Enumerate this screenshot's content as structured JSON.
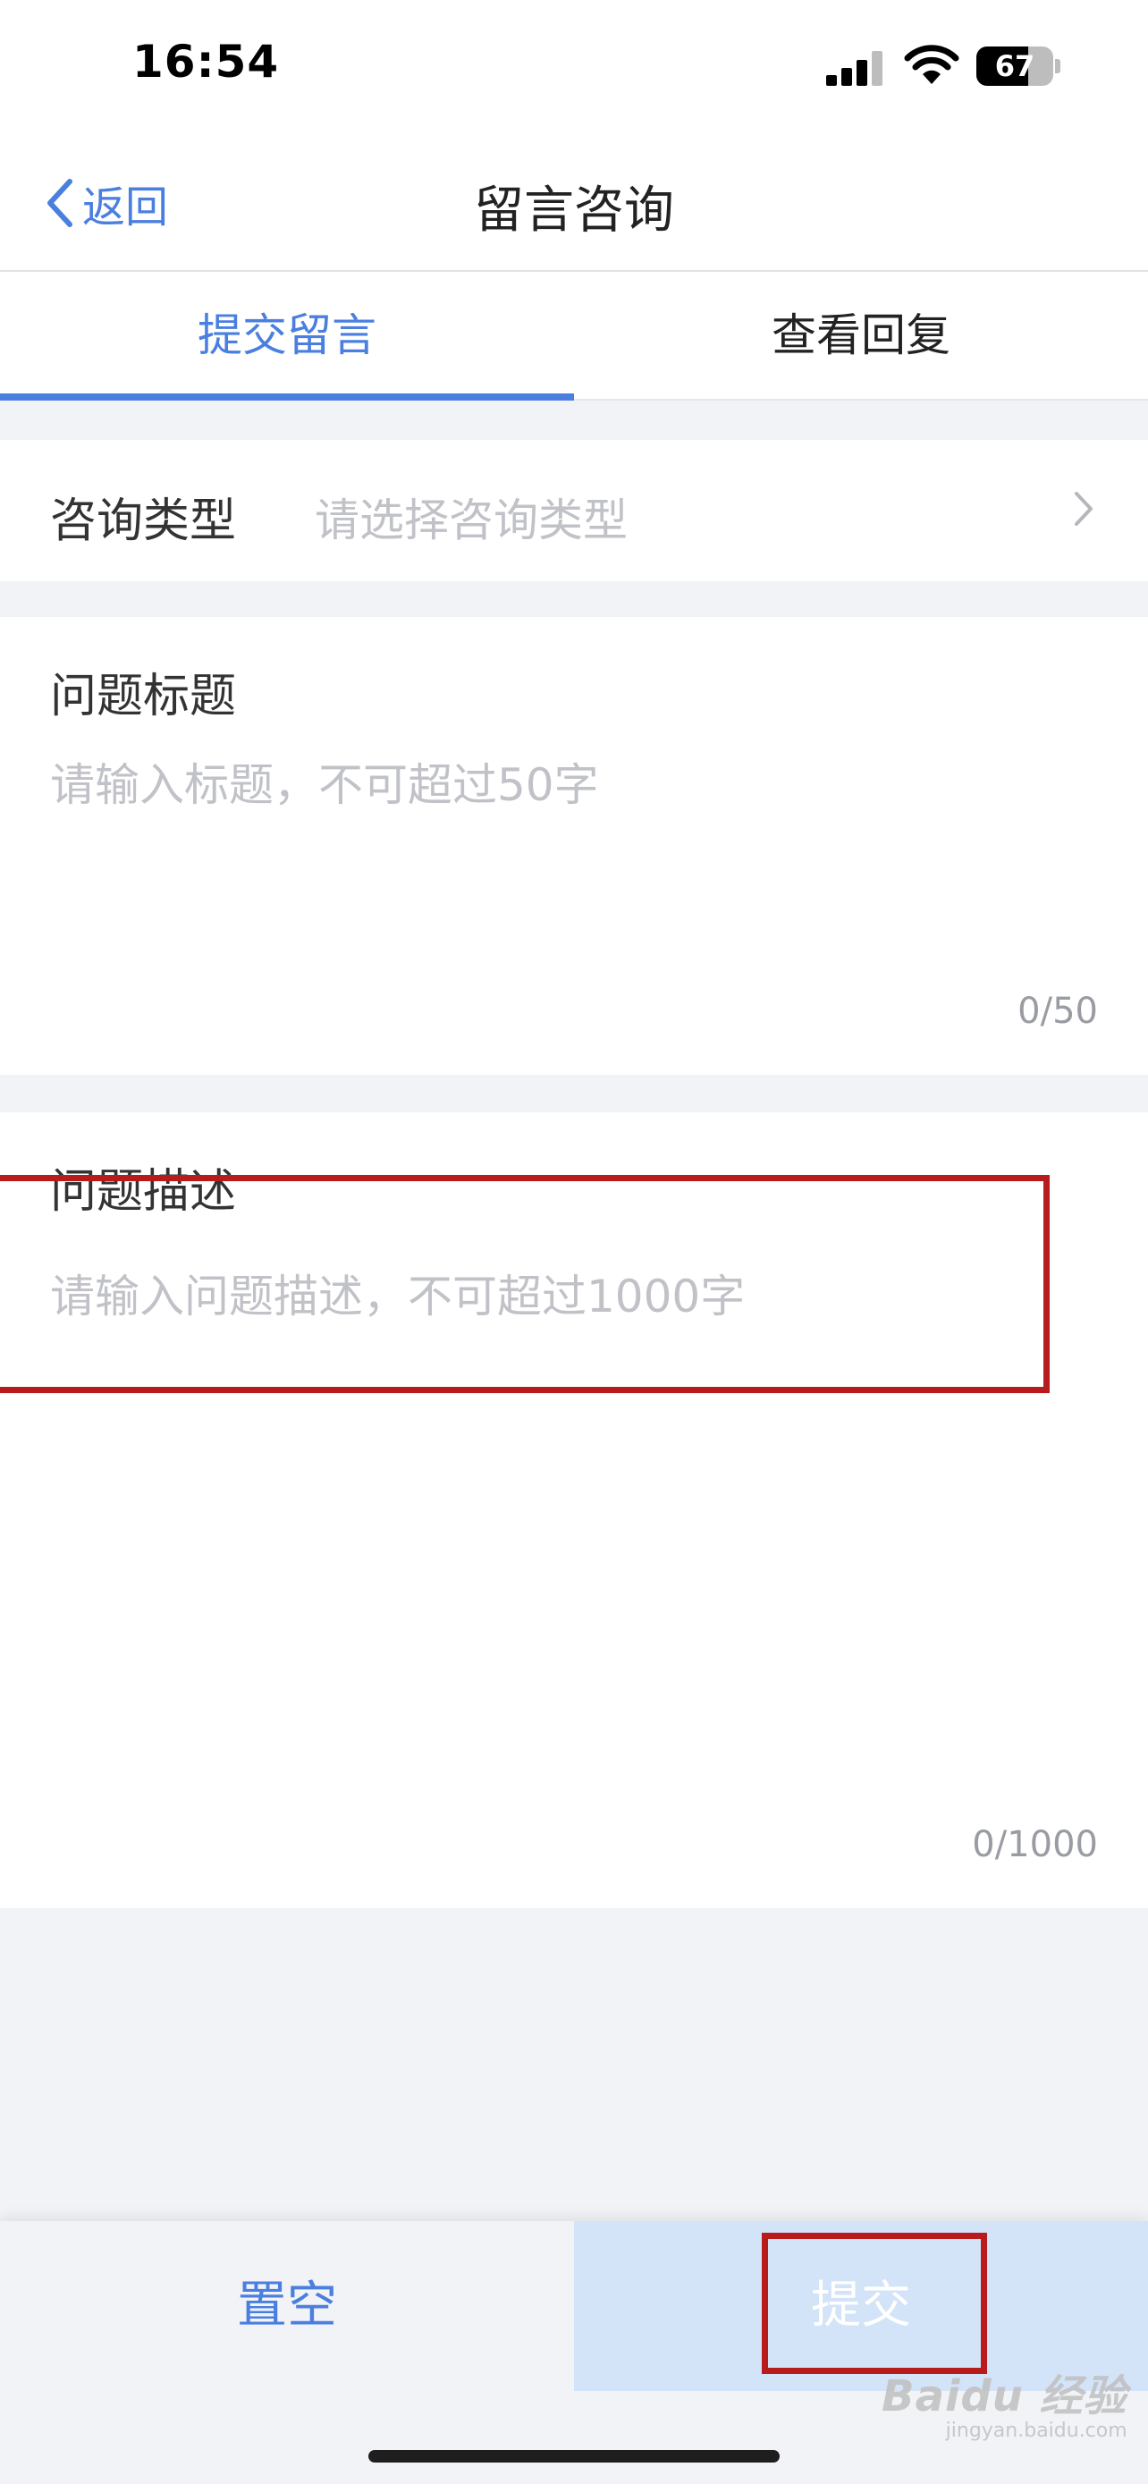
{
  "status_bar": {
    "time": "16:54",
    "battery_level": 67,
    "battery_text": "67"
  },
  "nav": {
    "back_label": "返回",
    "title": "留言咨询"
  },
  "tabs": [
    {
      "label": "提交留言",
      "active": true
    },
    {
      "label": "查看回复",
      "active": false
    }
  ],
  "form": {
    "consult_type": {
      "label": "咨询类型",
      "placeholder": "请选择咨询类型"
    },
    "question_title": {
      "label": "问题标题",
      "placeholder": "请输入标题，不可超过50字",
      "counter": "0/50"
    },
    "question_desc": {
      "label": "问题描述",
      "placeholder": "请输入问题描述，不可超过1000字",
      "counter": "0/1000"
    }
  },
  "actions": {
    "reset_label": "置空",
    "submit_label": "提交"
  },
  "watermark": {
    "brand": "Baidu 经验",
    "sub": "jingyan.baidu.com"
  },
  "colors": {
    "accent": "#4a7fe0",
    "annotation": "#b81b1b",
    "submit_bg": "#d3e3f8"
  },
  "icons": {
    "back": "chevron-left-icon",
    "row_arrow": "chevron-right-icon"
  }
}
